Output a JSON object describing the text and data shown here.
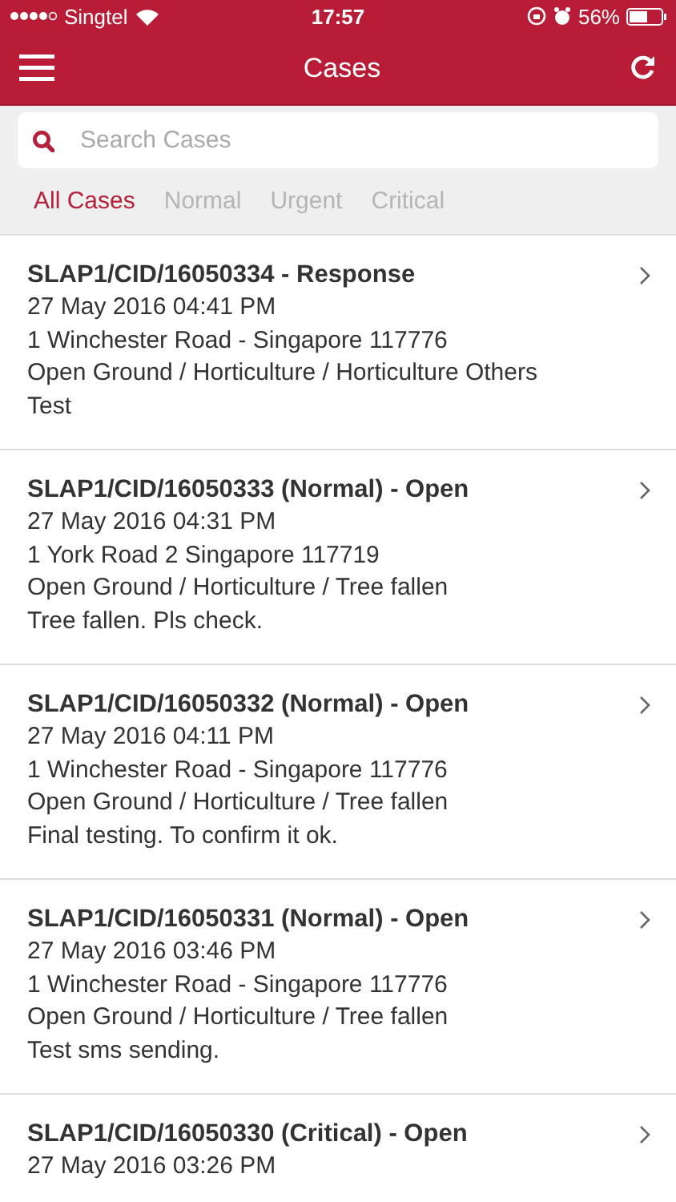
{
  "status_bar": {
    "carrier": "Singtel",
    "time": "17:57",
    "battery": "56%"
  },
  "nav": {
    "title": "Cases"
  },
  "search": {
    "placeholder": "Search Cases"
  },
  "filters": [
    {
      "label": "All Cases",
      "selected": true
    },
    {
      "label": "Normal",
      "selected": false
    },
    {
      "label": "Urgent",
      "selected": false
    },
    {
      "label": "Critical",
      "selected": false
    }
  ],
  "cases": [
    {
      "title": "SLAP1/CID/16050334 - Response",
      "date": "27 May 2016 04:41 PM",
      "address": "1 Winchester Road - Singapore 117776",
      "category": "Open Ground / Horticulture / Horticulture Others",
      "note": "Test"
    },
    {
      "title": "SLAP1/CID/16050333 (Normal) - Open",
      "date": "27 May 2016 04:31 PM",
      "address": "1 York Road 2 Singapore 117719",
      "category": "Open Ground / Horticulture / Tree fallen",
      "note": "Tree fallen. Pls check."
    },
    {
      "title": "SLAP1/CID/16050332 (Normal) - Open",
      "date": "27 May 2016 04:11 PM",
      "address": "1 Winchester Road - Singapore 117776",
      "category": "Open Ground / Horticulture / Tree fallen",
      "note": "Final testing. To confirm it ok."
    },
    {
      "title": "SLAP1/CID/16050331 (Normal) - Open",
      "date": "27 May 2016 03:46 PM",
      "address": "1 Winchester Road - Singapore 117776",
      "category": "Open Ground / Horticulture / Tree fallen",
      "note": "Test sms sending."
    },
    {
      "title": "SLAP1/CID/16050330 (Critical) - Open",
      "date": "27 May 2016 03:26 PM"
    }
  ]
}
